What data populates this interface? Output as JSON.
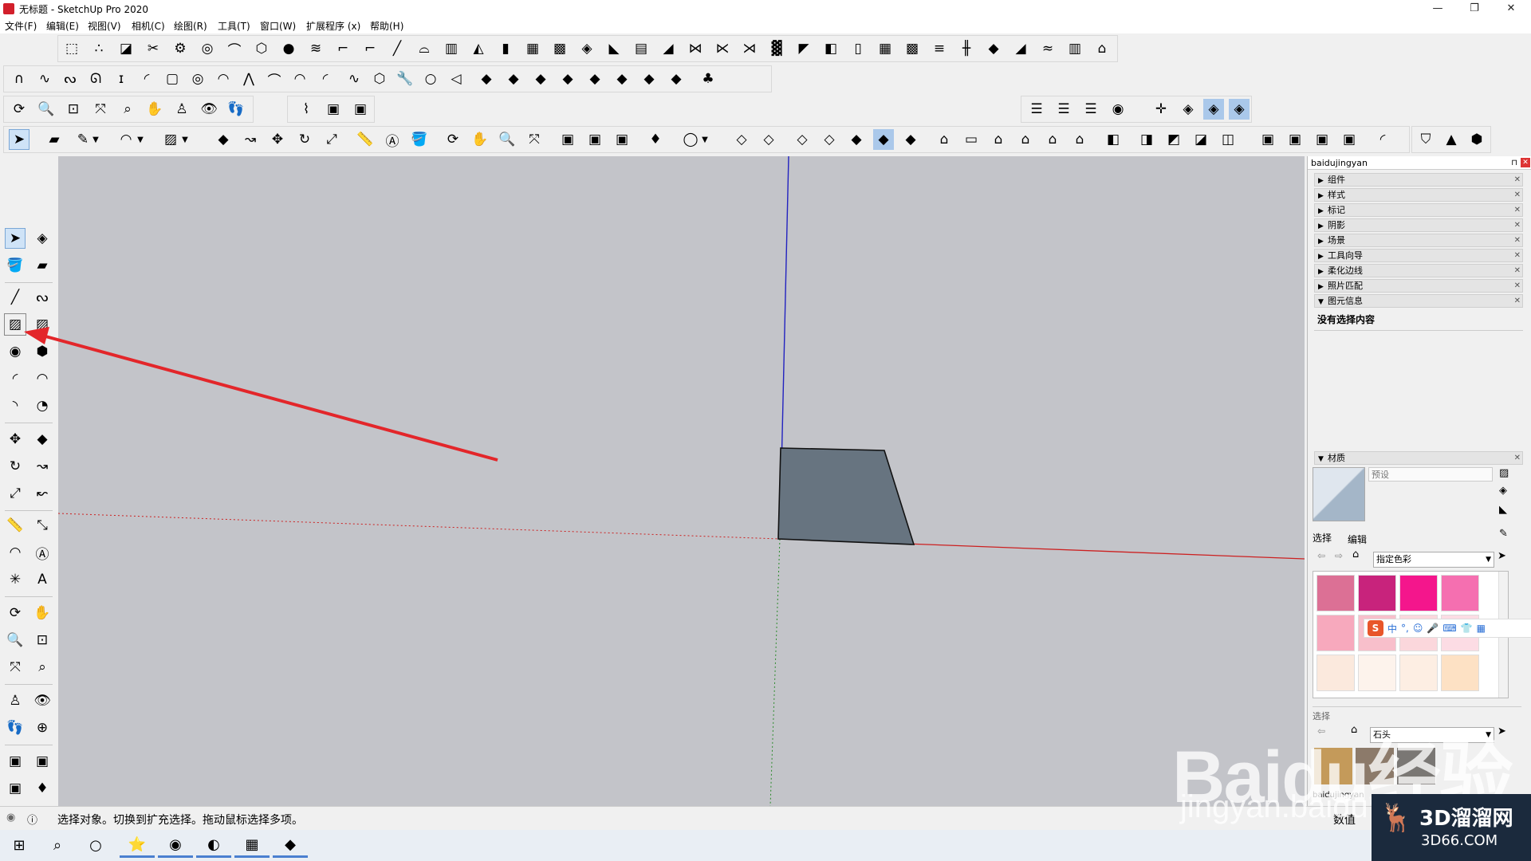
{
  "window": {
    "title": "无标题 - SketchUp Pro 2020",
    "minimize": "—",
    "restore": "❐",
    "close": "✕"
  },
  "menu": [
    {
      "label": "文件(F)"
    },
    {
      "label": "编辑(E)"
    },
    {
      "label": "视图(V)"
    },
    {
      "label": "相机(C)"
    },
    {
      "label": "绘图(R)"
    },
    {
      "label": "工具(T)"
    },
    {
      "label": "窗口(W)"
    },
    {
      "label": "扩展程序 (x)"
    },
    {
      "label": "帮助(H)"
    }
  ],
  "tray": {
    "title": "baidujingyan",
    "panels": [
      {
        "label": "组件"
      },
      {
        "label": "样式"
      },
      {
        "label": "标记"
      },
      {
        "label": "阴影"
      },
      {
        "label": "场景"
      },
      {
        "label": "工具向导"
      },
      {
        "label": "柔化边线"
      },
      {
        "label": "照片匹配"
      },
      {
        "label": "图元信息"
      }
    ],
    "entity_info_text": "没有选择内容",
    "materials": {
      "header": "材质",
      "name_placeholder": "预设",
      "tab_select": "选择",
      "tab_edit": "编辑",
      "library": "指定色彩",
      "library2": "石头",
      "select_label": "选择",
      "swatches": [
        "#dc7095",
        "#c8237c",
        "#f4168c",
        "#f56fb0",
        "#f7a9bd",
        "#f8bfcb",
        "#fbd7dc",
        "#fcdce4",
        "#fbe9dd",
        "#fdf3ec",
        "#fdeee3",
        "#fde1c4"
      ]
    },
    "bottom_tab": "baidujingyan",
    "data_label": "数值"
  },
  "ime_bar": {
    "logo": "S",
    "items": [
      "中",
      "°,",
      "☺",
      "🎤",
      "⌨",
      "👕",
      "▦"
    ]
  },
  "status": {
    "message": "选择对象。切换到扩充选择。拖动鼠标选择多项。"
  },
  "watermark": {
    "main": "Baidu经验",
    "sub": "jingyan.baidu",
    "brand": "3D溜溜网",
    "brand_url": "3D66.COM"
  },
  "colors": {
    "viewport_bg": "#c3c4c9",
    "face_color": "#677480",
    "axis_red": "#cc2020",
    "axis_blue": "#2222c0",
    "axis_green": "#2a8a2a",
    "annotation_arrow": "#e3262a"
  }
}
